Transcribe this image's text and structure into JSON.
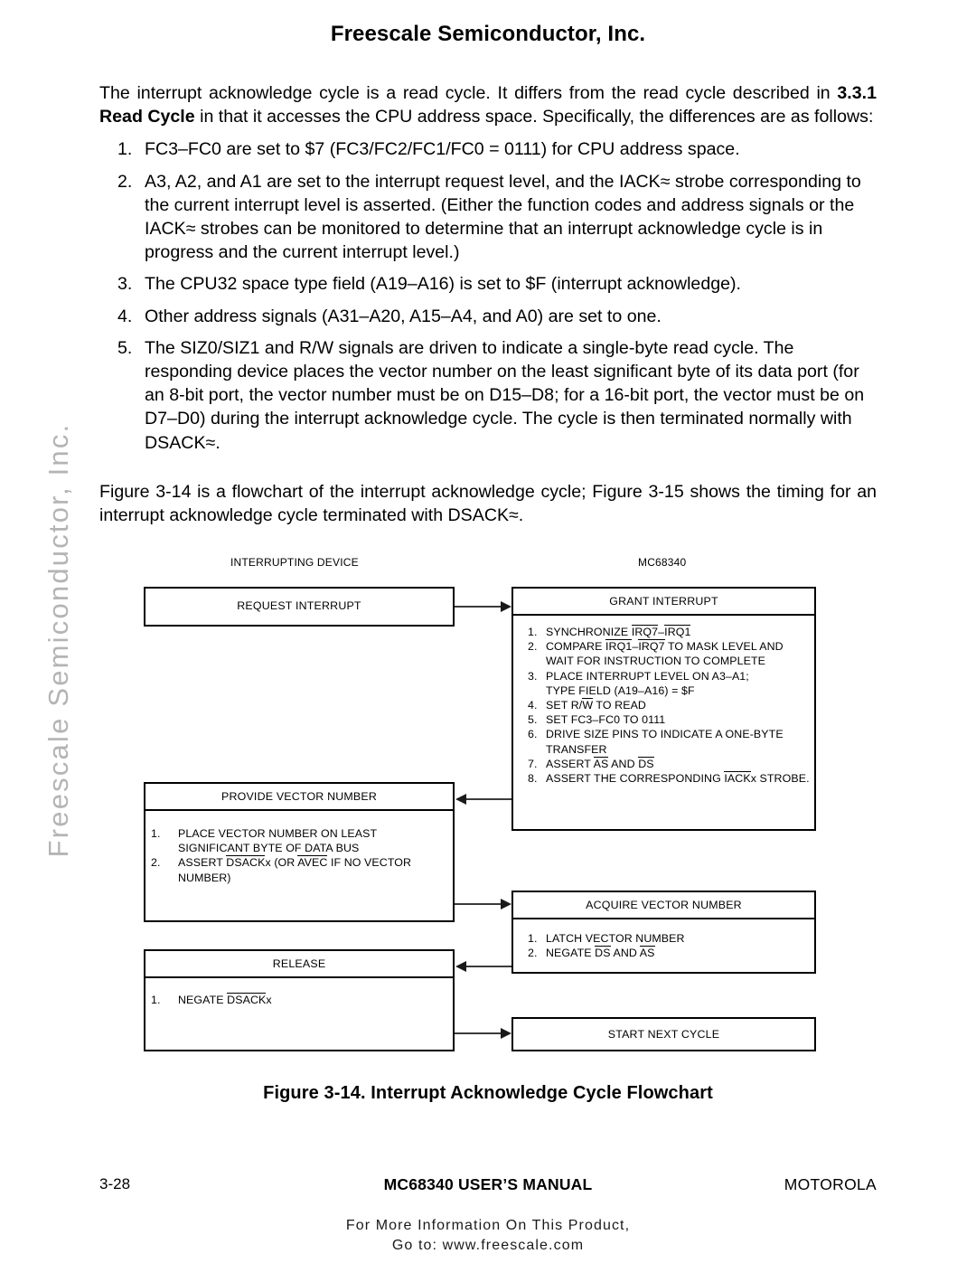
{
  "watermark": "Freescale Semiconductor, Inc.",
  "header": {
    "title": "Freescale Semiconductor, Inc."
  },
  "body": {
    "intro_part1": "The interrupt acknowledge cycle is a read cycle. It differs from the read cycle described in ",
    "intro_bold": "3.3.1 Read Cycle",
    "intro_part2": " in that it accesses the CPU address space. Specifically, the differences are as follows:",
    "items": [
      {
        "num": "1.",
        "text": "FC3–FC0 are set to $7 (FC3/FC2/FC1/FC0 = 0111) for CPU address space."
      },
      {
        "num": "2.",
        "text": "A3, A2, and A1 are set to the interrupt request level, and the IACK≈ strobe corresponding to the current interrupt level is asserted. (Either the function codes and address signals or the IACK≈ strobes can be monitored to determine that an interrupt acknowledge cycle is in progress and the current interrupt level.)"
      },
      {
        "num": "3.",
        "text": "The CPU32 space type field (A19–A16) is set to $F (interrupt acknowledge)."
      },
      {
        "num": "4.",
        "text": "Other address signals (A31–A20, A15–A4, and A0) are set to one."
      },
      {
        "num": "5.",
        "text": "The SIZ0/SIZ1 and R/W signals are driven to indicate a single-byte read cycle. The responding device places the vector number on the least significant byte of its data port (for an 8-bit port, the vector number must be on D15–D8; for a 16-bit port, the vector must be on D7–D0) during the interrupt acknowledge cycle. The cycle is then terminated normally with DSACK≈."
      }
    ],
    "figure_ref": "Figure 3-14 is a flowchart of the interrupt acknowledge cycle; Figure 3-15 shows the timing for an interrupt acknowledge cycle terminated with DSACK≈."
  },
  "flowchart": {
    "column_headings": {
      "left": "INTERRUPTING DEVICE",
      "right": "MC68340"
    },
    "boxes": {
      "request_interrupt": {
        "title": "REQUEST INTERRUPT"
      },
      "grant_interrupt": {
        "title": "GRANT INTERRUPT",
        "steps": [
          {
            "n": "1.",
            "pre": "SYNCHRONIZE ",
            "bar1": "IRQ7",
            "mid": "–",
            "bar2": "IRQ1",
            "post": ""
          },
          {
            "n": "2.",
            "pre": "COMPARE ",
            "bar1": "IRQ1",
            "mid": "–",
            "bar2": "IRQ7",
            "post": " TO MASK LEVEL AND",
            "cont": "WAIT FOR INSTRUCTION TO COMPLETE"
          },
          {
            "n": "3.",
            "pre": "PLACE INTERRUPT LEVEL ON A3–A1;",
            "cont": "TYPE FIELD (A19–A16) = $F"
          },
          {
            "n": "4.",
            "pre": "SET R/",
            "bar1": "W",
            "post": " TO READ"
          },
          {
            "n": "5.",
            "pre": "SET FC3–FC0 TO 0111"
          },
          {
            "n": "6.",
            "pre": "DRIVE SIZE PINS TO INDICATE A ONE-BYTE",
            "cont": "TRANSFER"
          },
          {
            "n": "7.",
            "pre": "ASSERT ",
            "bar1": "AS",
            "mid": " AND ",
            "bar2": "DS",
            "post": ""
          },
          {
            "n": "8.",
            "pre": "ASSERT THE CORRESPONDING ",
            "bar1": "IACK",
            "post": "x STROBE."
          }
        ]
      },
      "provide_vector_number": {
        "title": "PROVIDE VECTOR NUMBER",
        "steps": [
          {
            "n": "1.",
            "pre": "PLACE VECTOR NUMBER ON LEAST",
            "cont": "SIGNIFICANT BYTE OF DATA BUS"
          },
          {
            "n": "2.",
            "pre": "ASSERT ",
            "bar1": "DSACK",
            "mid": "x (OR ",
            "bar2": "AVEC",
            "post": " IF NO VECTOR",
            "cont": "NUMBER)"
          }
        ]
      },
      "acquire_vector_number": {
        "title": "ACQUIRE VECTOR NUMBER",
        "steps": [
          {
            "n": "1.",
            "pre": "LATCH VECTOR NUMBER"
          },
          {
            "n": "2.",
            "pre": "NEGATE ",
            "bar1": "DS",
            "mid": " AND ",
            "bar2": "AS",
            "post": ""
          }
        ]
      },
      "release": {
        "title": "RELEASE",
        "steps": [
          {
            "n": "1.",
            "pre": "NEGATE ",
            "bar1": "DSACK",
            "post": "x"
          }
        ]
      },
      "start_next_cycle": {
        "title": "START NEXT CYCLE"
      }
    }
  },
  "caption": "Figure 3-14. Interrupt Acknowledge Cycle Flowchart",
  "footer": {
    "page_number": "3-28",
    "manual_title": "MC68340 USER’S MANUAL",
    "brand": "MOTOROLA",
    "note_line1": "For More Information On This Product,",
    "note_line2": "Go to: www.freescale.com"
  }
}
